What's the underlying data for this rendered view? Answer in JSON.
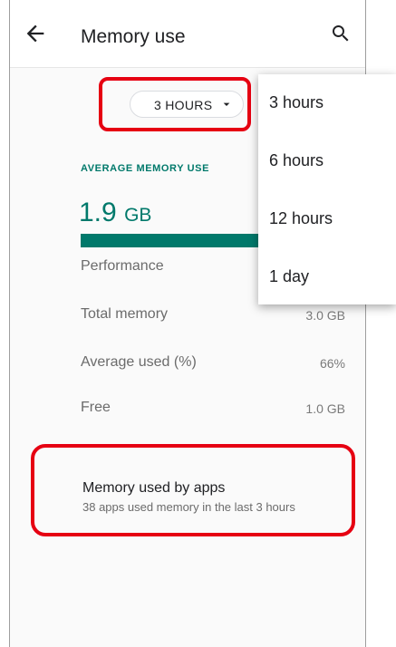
{
  "appbar": {
    "title": "Memory use",
    "back_icon": "arrow-back-icon",
    "search_icon": "search-icon"
  },
  "period_selector": {
    "label": "3 HOURS",
    "caret_icon": "dropdown-arrow-icon"
  },
  "summary": {
    "heading": "AVERAGE MEMORY USE",
    "value": "1.9",
    "unit": "GB",
    "usage_fraction": 0.66,
    "accent_color": "#00796b"
  },
  "stats": [
    {
      "label": "Performance",
      "value": ""
    },
    {
      "label": "Total memory",
      "value": "3.0 GB"
    },
    {
      "label": "Average used (%)",
      "value": "66%"
    },
    {
      "label": "Free",
      "value": "1.0 GB"
    }
  ],
  "apps": {
    "title": "Memory used by apps",
    "subtitle": "38 apps used memory in the last 3 hours"
  },
  "dropdown_menu": {
    "options": [
      "3 hours",
      "6 hours",
      "12 hours",
      "1 day"
    ]
  },
  "highlight_color": "#e60012"
}
